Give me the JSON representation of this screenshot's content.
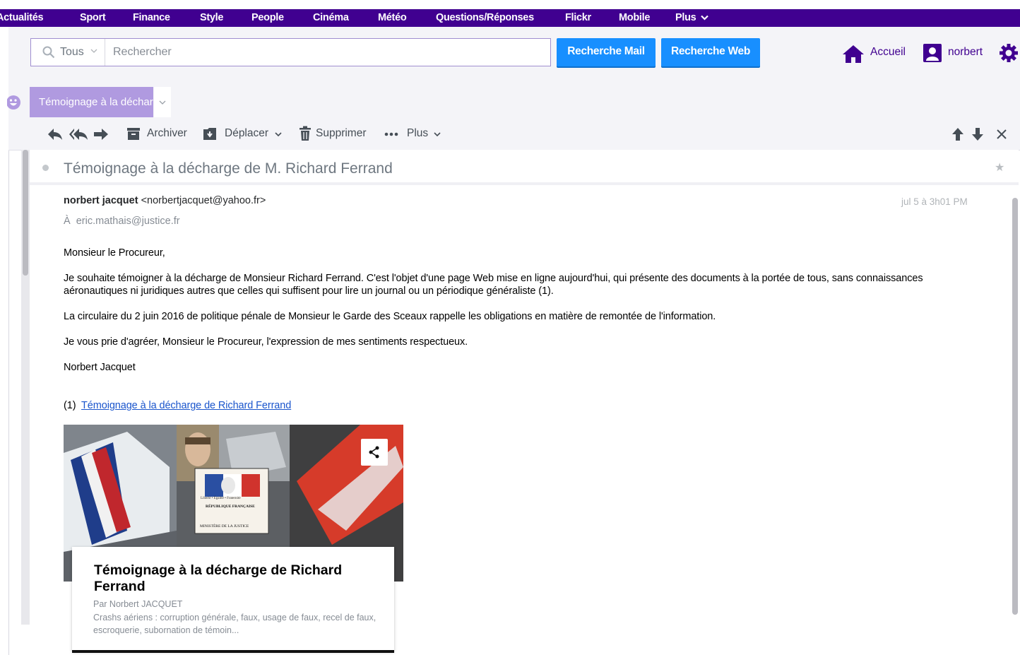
{
  "nav": {
    "items": [
      "Actualités",
      "Sport",
      "Finance",
      "Style",
      "People",
      "Cinéma",
      "Météo",
      "Questions/Réponses",
      "Flickr",
      "Mobile",
      "Plus"
    ]
  },
  "search": {
    "scope_label": "Tous",
    "placeholder": "Rechercher",
    "value": "",
    "mail_button": "Recherche Mail",
    "web_button": "Recherche Web"
  },
  "header": {
    "home_label": "Accueil",
    "user_label": "norbert"
  },
  "tab": {
    "label": "Témoignage à la décharge de M. Richard Ferrand"
  },
  "toolbar": {
    "archive": "Archiver",
    "move": "Déplacer",
    "delete": "Supprimer",
    "more": "Plus"
  },
  "message": {
    "subject": "Témoignage à la décharge de M. Richard Ferrand",
    "sender_name": "norbert jacquet",
    "sender_email": "<norbertjacquet@yahoo.fr>",
    "date": "jul 5 à 3h01 PM",
    "to_label": "À",
    "to_address": "eric.mathais@justice.fr",
    "body": {
      "greeting": "Monsieur le Procureur,",
      "p1": "Je souhaite témoigner à la décharge de Monsieur Richard Ferrand. C'est l'objet d'une page Web mise en ligne aujourd'hui, qui présente des documents à la portée de tous, sans connaissances aéronautiques ni juridiques autres que celles qui suffisent pour lire un journal ou un périodique généraliste (1).",
      "p2": "La circulaire du 2 juin 2016 de politique pénale de Monsieur le Garde des Sceaux rappelle les obligations en matière de remontée de l'information.",
      "p3": "Je vous prie d'agréer, Monsieur le Procureur, l'expression de mes sentiments respectueux.",
      "signature": "Norbert Jacquet",
      "footnote_marker": "(1)",
      "footnote_link": "Témoignage à la décharge de Richard Ferrand"
    },
    "card": {
      "title": "Témoignage à la décharge de Richard Ferrand",
      "author": "Par Norbert JACQUET",
      "description": "Crashs aériens : corruption générale, faux, usage de faux, recel de faux, escroquerie, subornation de témoin...",
      "image_text": {
        "motto": "Liberté • Égalité • Fraternité",
        "republic": "RÉPUBLIQUE FRANÇAISE",
        "ministry": "MINISTÈRE DE LA JUSTICE"
      }
    }
  },
  "colors": {
    "nav_bg": "#400090",
    "button_blue": "#188fff",
    "tab_bg": "#b09ae0",
    "link": "#1a55cc"
  },
  "icons": [
    "search-icon",
    "home-icon",
    "user-icon",
    "gear-icon",
    "reply-icon",
    "reply-all-icon",
    "forward-icon",
    "archive-icon",
    "move-icon",
    "trash-icon",
    "more-icon",
    "arrow-up-icon",
    "arrow-down-icon",
    "close-icon",
    "star-icon",
    "share-icon",
    "smiley-icon"
  ]
}
